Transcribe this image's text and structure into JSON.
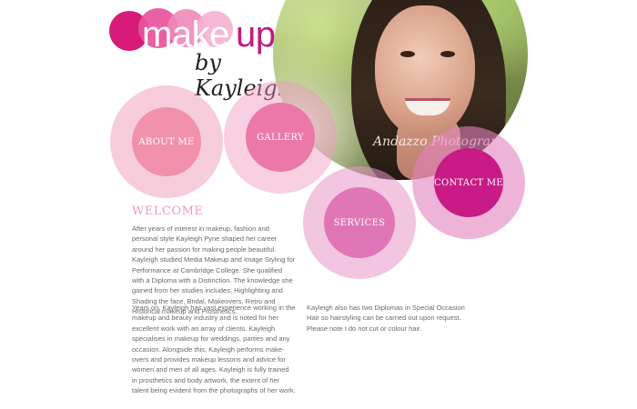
{
  "logo": {
    "word_make": "make",
    "word_up": "up",
    "tagline": "by Kayleigh"
  },
  "photo": {
    "watermark": "Andazzo Photography"
  },
  "nav": {
    "about": "ABOUT ME",
    "gallery": "GALLERY",
    "services": "SERVICES",
    "contact": "CONTACT ME"
  },
  "content": {
    "heading": "WELCOME",
    "para1": "After years of interest in makeup, fashion and personal style Kayleigh Pyne shaped her career around her passion for making people beautiful. Kayleigh studied Media Makeup and Image Styling for Performance at Cambridge College. She qualified with a Diploma with a Distinction. The knowledge she gained from her studies includes; Highlighting and Shading the face, Bridal, Makeovers, Retro and Historical makeup and Prosthetics.",
    "para2": "Years on, Kayleigh has vast experience working in the makeup and beauty industry and is noted for her excellent work with an array of clients. Kayleigh specialises in makeup for weddings, parties and any occasion. Alongside this, Kayleigh performs make-overs and provides makeup lessons and advice for women and men of all ages. Kayleigh is fully trained in prosthetics and body artwork, the extent of her talent being evident from the photographs of her work.",
    "para3": "Kayleigh also has two Diplomas in Special Occasion Hair so hairstyling can be carried out upon request. Please note I do not cut or colour hair."
  },
  "colors": {
    "brand_magenta": "#c21a83",
    "heading_pink": "#f29ab6"
  }
}
